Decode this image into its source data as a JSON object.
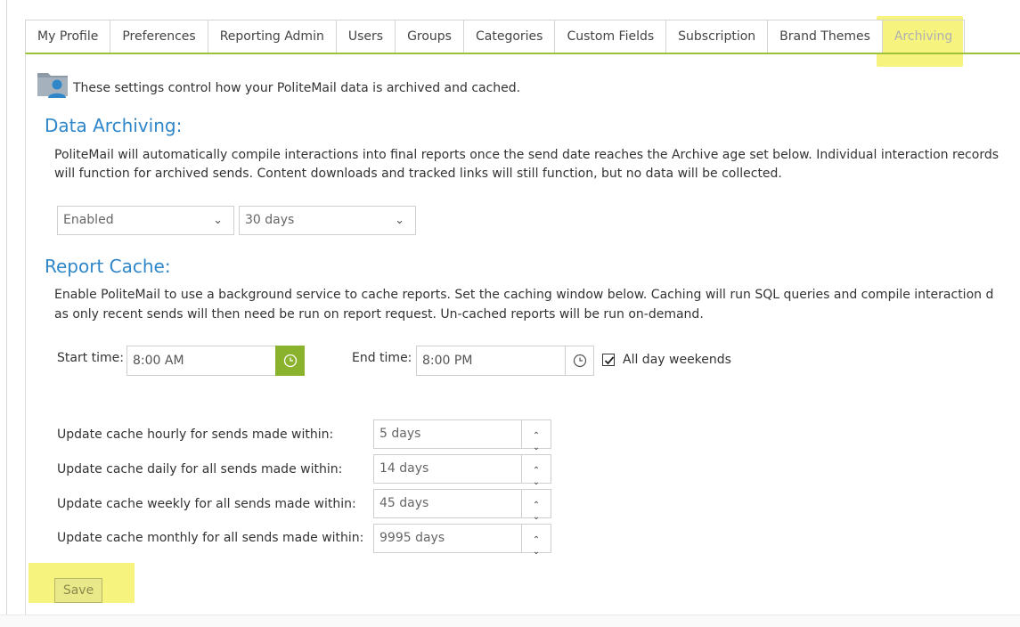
{
  "tabs": [
    {
      "label": "My Profile"
    },
    {
      "label": "Preferences"
    },
    {
      "label": "Reporting Admin"
    },
    {
      "label": "Users"
    },
    {
      "label": "Groups"
    },
    {
      "label": "Categories"
    },
    {
      "label": "Custom Fields"
    },
    {
      "label": "Subscription"
    },
    {
      "label": "Brand Themes"
    },
    {
      "label": "Archiving",
      "active": true
    }
  ],
  "intro": "These settings control how your PoliteMail data is archived and cached.",
  "archiving": {
    "heading": "Data Archiving:",
    "line1": "PoliteMail will automatically compile interactions into final reports once the send date reaches the Archive age set below. Individual interaction records",
    "line2": "will function for archived sends. Content downloads and tracked links will still function, but no data will be collected.",
    "status_value": "Enabled",
    "age_value": "30 days"
  },
  "cache": {
    "heading": "Report Cache:",
    "line1": "Enable PoliteMail to use a background service to cache reports. Set the caching window below. Caching will run SQL queries and compile interaction d",
    "line2": "as only recent sends will then need be run on report request. Un-cached reports will be run on-demand.",
    "start_label": "Start time:",
    "start_value": "8:00 AM",
    "end_label": "End time:",
    "end_value": "8:00 PM",
    "weekends_label": "All day weekends",
    "weekends_checked": true,
    "rows": [
      {
        "label": "Update cache hourly for sends made within:",
        "value": "5 days"
      },
      {
        "label": "Update cache daily for all sends made within:",
        "value": "14 days"
      },
      {
        "label": "Update cache weekly for all sends made within:",
        "value": "45 days"
      },
      {
        "label": "Update cache monthly for all sends made within:",
        "value": "9995 days"
      }
    ]
  },
  "save_label": "Save",
  "colors": {
    "accent": "#2f86c9",
    "active_border": "#9dc23a",
    "highlight": "#f6f47f",
    "clock_green": "#8bb22d"
  }
}
